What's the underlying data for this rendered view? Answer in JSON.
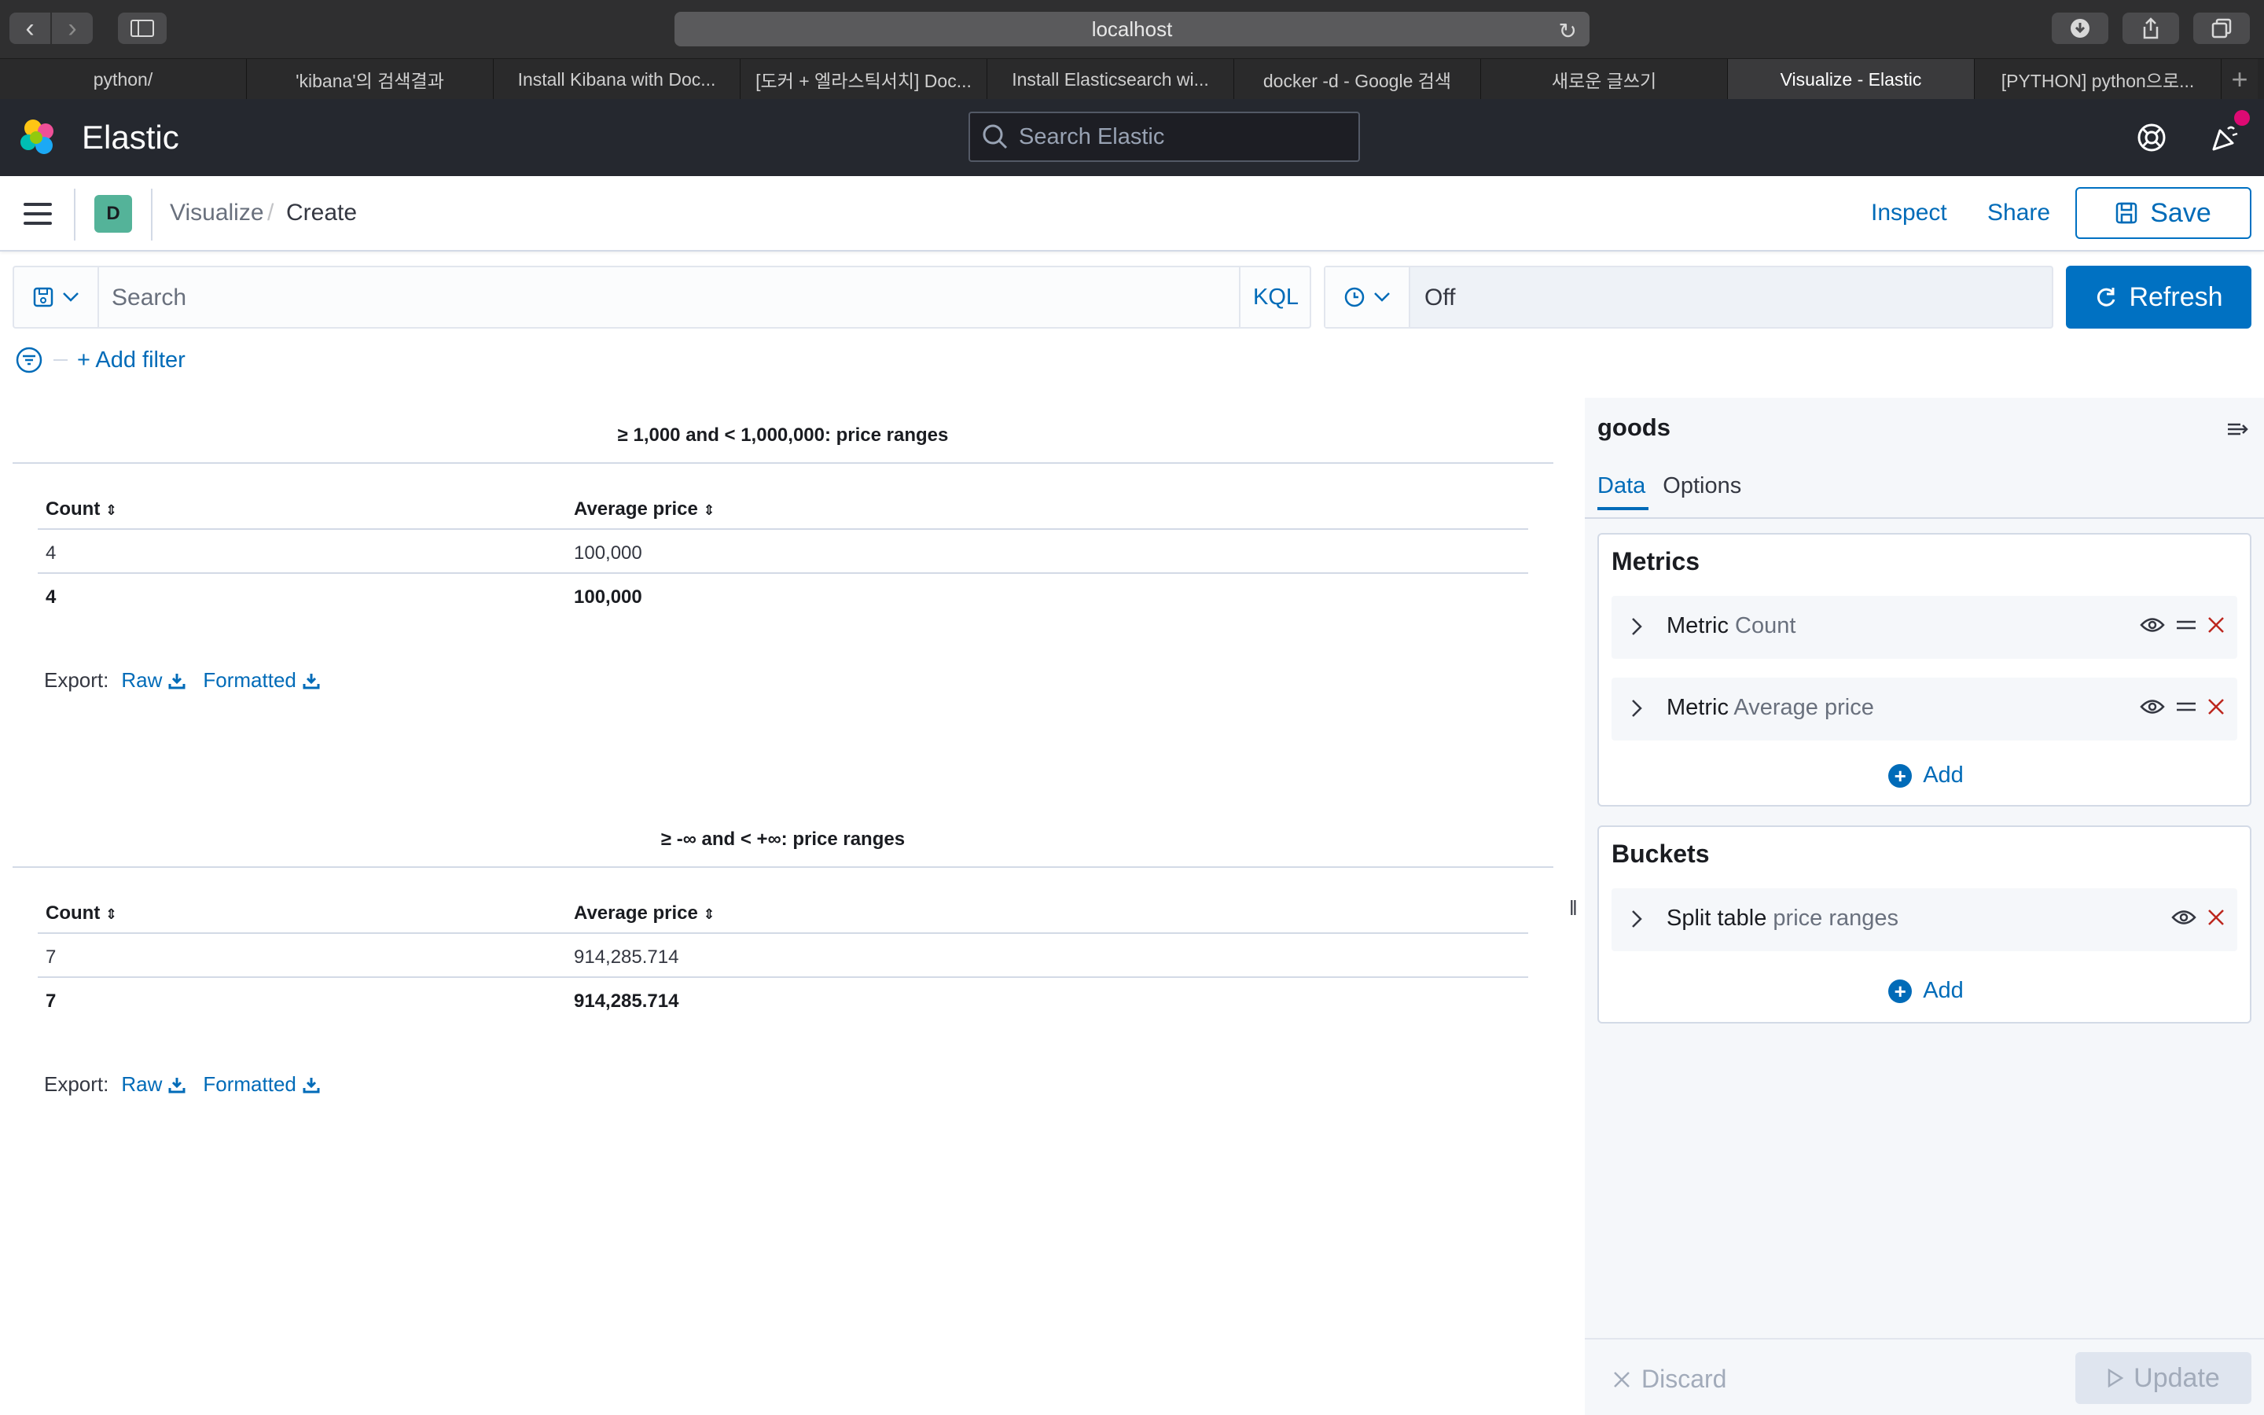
{
  "browser": {
    "url": "localhost",
    "tabs": [
      "python/",
      "'kibana'의 검색결과",
      "Install Kibana with Doc...",
      "[도커 + 엘라스틱서치] Doc...",
      "Install Elasticsearch wi...",
      "docker -d - Google 검색",
      "새로운 글쓰기",
      "Visualize - Elastic",
      "[PYTHON] python으로..."
    ],
    "active_tab_index": 7
  },
  "header": {
    "brand": "Elastic",
    "search_placeholder": "Search Elastic"
  },
  "breadcrumb": {
    "space_initial": "D",
    "items": [
      "Visualize",
      "Create"
    ],
    "separator": "/"
  },
  "actions": {
    "inspect": "Inspect",
    "share": "Share",
    "save": "Save"
  },
  "query": {
    "placeholder": "Search",
    "language": "KQL",
    "refresh_value": "Off",
    "refresh_label": "Refresh",
    "add_filter": "+ Add filter"
  },
  "tables": [
    {
      "title": "≥ 1,000 and < 1,000,000: price ranges",
      "columns": [
        "Count",
        "Average price"
      ],
      "rows": [
        [
          "4",
          "100,000"
        ]
      ],
      "totals": [
        "4",
        "100,000"
      ]
    },
    {
      "title": "≥ -∞ and < +∞: price ranges",
      "columns": [
        "Count",
        "Average price"
      ],
      "rows": [
        [
          "7",
          "914,285.714"
        ]
      ],
      "totals": [
        "7",
        "914,285.714"
      ]
    }
  ],
  "export": {
    "label": "Export:",
    "raw": "Raw",
    "formatted": "Formatted"
  },
  "panel": {
    "index_name": "goods",
    "tabs": [
      "Data",
      "Options"
    ],
    "metrics": {
      "title": "Metrics",
      "items": [
        {
          "type": "Metric",
          "name": "Count"
        },
        {
          "type": "Metric",
          "name": "Average price"
        }
      ],
      "add_label": "Add"
    },
    "buckets": {
      "title": "Buckets",
      "items": [
        {
          "type": "Split table",
          "name": "price ranges"
        }
      ],
      "add_label": "Add"
    },
    "discard": "Discard",
    "update": "Update"
  }
}
